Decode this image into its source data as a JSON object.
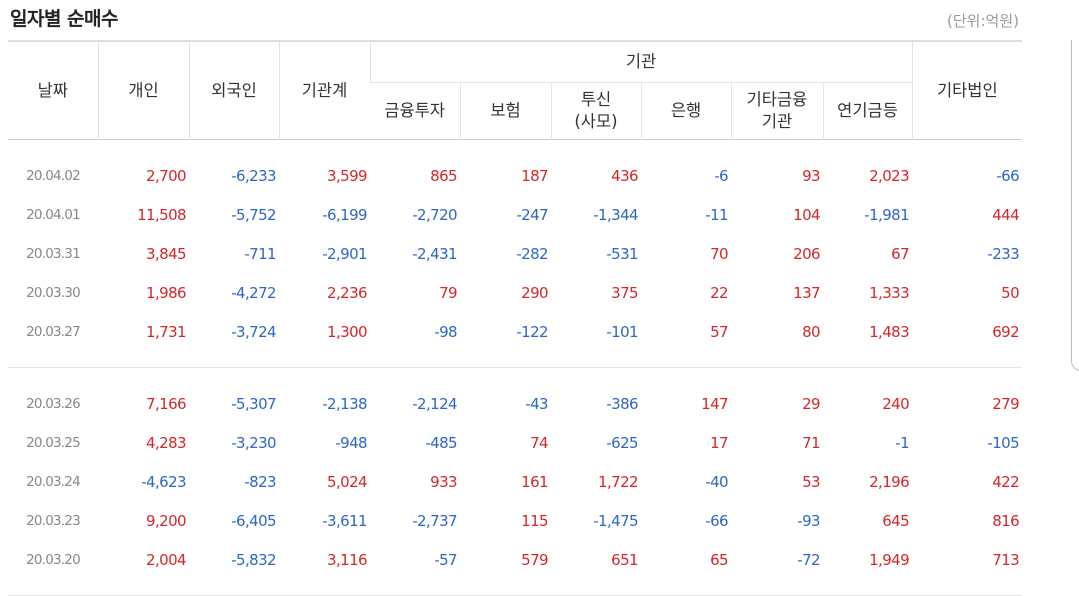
{
  "title": "일자별 순매수",
  "unit": "(단위:억원)",
  "headers": {
    "date": "날짜",
    "individual": "개인",
    "foreign": "외국인",
    "inst_total": "기관계",
    "inst_group": "기관",
    "finance_inv": "금융투자",
    "insurance": "보험",
    "trust_line1": "투신",
    "trust_line2": "(사모)",
    "bank": "은행",
    "other_fin_line1": "기타금융",
    "other_fin_line2": "기관",
    "pension": "연기금등",
    "other_corp": "기타법인"
  },
  "rows": [
    [
      "20.04.02",
      "2,700",
      "-6,233",
      "3,599",
      "865",
      "187",
      "436",
      "-6",
      "93",
      "2,023",
      "-66"
    ],
    [
      "20.04.01",
      "11,508",
      "-5,752",
      "-6,199",
      "-2,720",
      "-247",
      "-1,344",
      "-11",
      "104",
      "-1,981",
      "444"
    ],
    [
      "20.03.31",
      "3,845",
      "-711",
      "-2,901",
      "-2,431",
      "-282",
      "-531",
      "70",
      "206",
      "67",
      "-233"
    ],
    [
      "20.03.30",
      "1,986",
      "-4,272",
      "2,236",
      "79",
      "290",
      "375",
      "22",
      "137",
      "1,333",
      "50"
    ],
    [
      "20.03.27",
      "1,731",
      "-3,724",
      "1,300",
      "-98",
      "-122",
      "-101",
      "57",
      "80",
      "1,483",
      "692"
    ],
    [
      "20.03.26",
      "7,166",
      "-5,307",
      "-2,138",
      "-2,124",
      "-43",
      "-386",
      "147",
      "29",
      "240",
      "279"
    ],
    [
      "20.03.25",
      "4,283",
      "-3,230",
      "-948",
      "-485",
      "74",
      "-625",
      "17",
      "71",
      "-1",
      "-105"
    ],
    [
      "20.03.24",
      "-4,623",
      "-823",
      "5,024",
      "933",
      "161",
      "1,722",
      "-40",
      "53",
      "2,196",
      "422"
    ],
    [
      "20.03.23",
      "9,200",
      "-6,405",
      "-3,611",
      "-2,737",
      "115",
      "-1,475",
      "-66",
      "-93",
      "645",
      "816"
    ],
    [
      "20.03.20",
      "2,004",
      "-5,832",
      "3,116",
      "-57",
      "579",
      "651",
      "65",
      "-72",
      "1,949",
      "713"
    ]
  ],
  "colors": {
    "positive": "#d3272a",
    "negative": "#2f66c4",
    "date": "#888888"
  }
}
